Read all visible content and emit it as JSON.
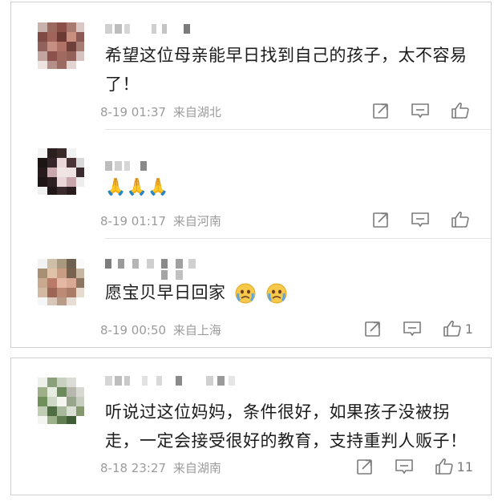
{
  "comments": [
    {
      "text": "希望这位母亲能早日找到自己的孩子，太不容易了！",
      "time": "8-19 01:37",
      "location": "来自湖北",
      "like_count": ""
    },
    {
      "text": "🙏🙏🙏",
      "time": "8-19 01:17",
      "location": "来自河南",
      "like_count": ""
    },
    {
      "text": "愿宝贝早日回家",
      "time": "8-19 00:50",
      "location": "来自上海",
      "like_count": "1"
    },
    {
      "text": "听说过这位妈妈，条件很好，如果孩子没被拐走，一定会接受很好的教育，支持重判人贩子！",
      "time": "8-18 23:27",
      "location": "来自湖南",
      "like_count": "11"
    }
  ],
  "icons": {
    "share": "share-icon",
    "comment": "comment-icon",
    "like": "thumbs-up-icon",
    "cry": "crying-face-emoji"
  },
  "colors": {
    "text": "#1c1c1c",
    "meta": "#9b9b9b",
    "icon": "#7b7b7b",
    "border": "#d0d0d0"
  }
}
